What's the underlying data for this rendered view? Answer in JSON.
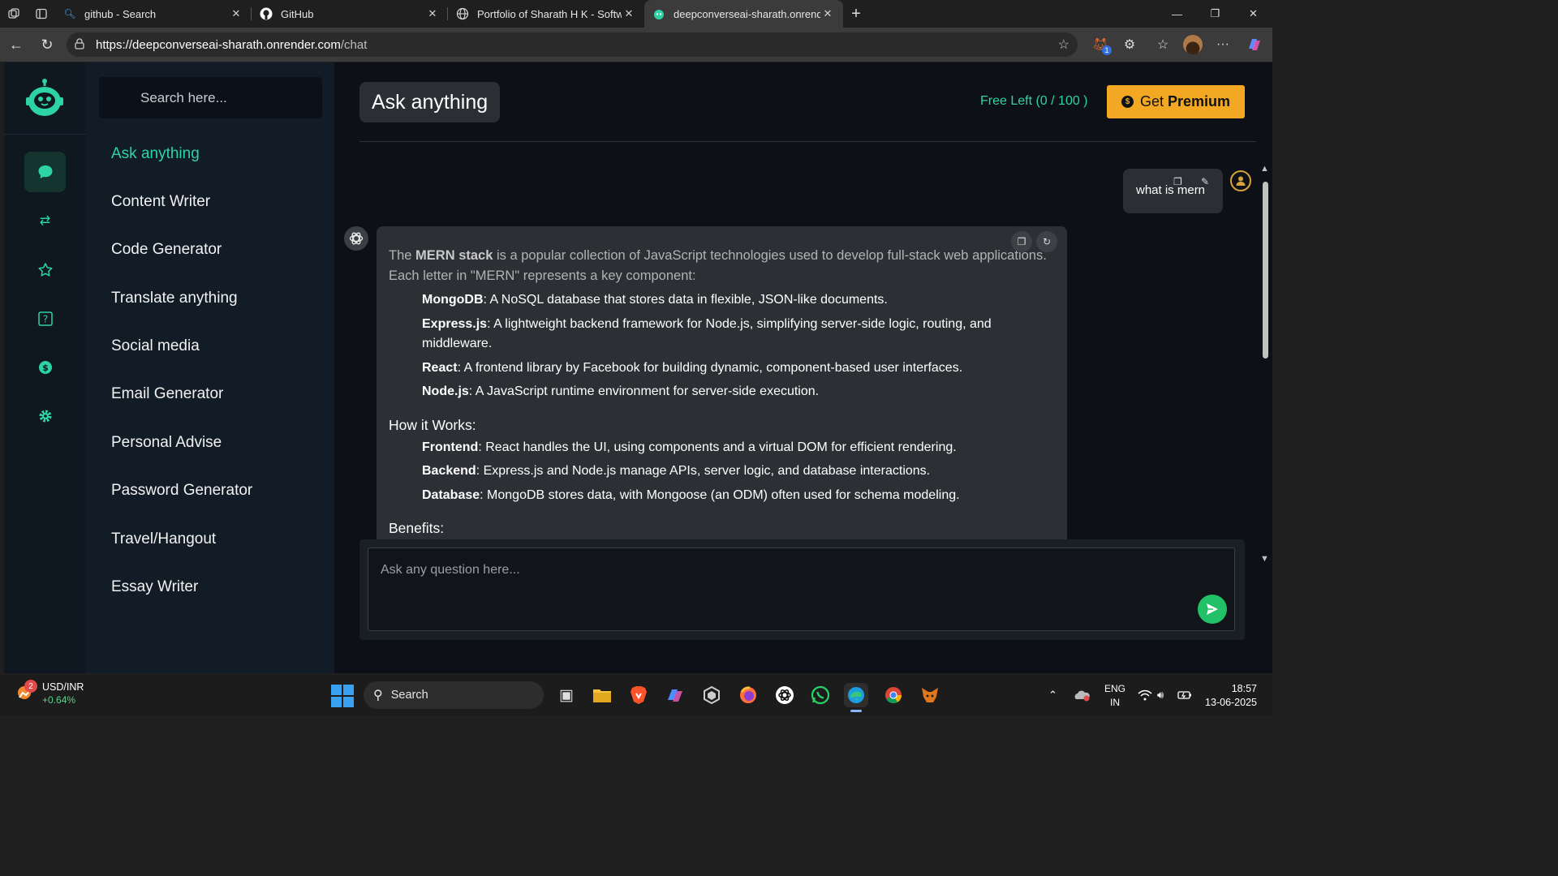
{
  "browser": {
    "tabs": [
      {
        "title": "github - Search",
        "icon": "search-icon"
      },
      {
        "title": "GitHub",
        "icon": "github-icon"
      },
      {
        "title": "Portfolio of Sharath H K - Softwar",
        "icon": "globe-icon"
      },
      {
        "title": "deepconverseai-sharath.onrender",
        "icon": "bot-favicon",
        "active": true
      }
    ],
    "url_host": "https://deepconverseai-sharath.onrender.com",
    "url_path": "/chat",
    "extension_badge": "1"
  },
  "sidebar": {
    "search_placeholder": "Search here...",
    "rail_icons": [
      "chat-icon",
      "swap-icon",
      "star-icon",
      "help-icon",
      "dollar-icon",
      "gear-icon"
    ],
    "items": [
      {
        "label": "Ask anything",
        "active": true
      },
      {
        "label": "Content Writer"
      },
      {
        "label": "Code Generator"
      },
      {
        "label": "Translate anything"
      },
      {
        "label": "Social media"
      },
      {
        "label": "Email Generator"
      },
      {
        "label": "Personal Advise"
      },
      {
        "label": "Password Generator"
      },
      {
        "label": "Travel/Hangout"
      },
      {
        "label": "Essay Writer"
      }
    ]
  },
  "header": {
    "title": "Ask anything",
    "free_left": "Free Left (0 / 100 )",
    "premium_prefix": "Get",
    "premium_bold": "Premium"
  },
  "chat": {
    "user_message": "what is mern",
    "bot": {
      "intro_pre": "The ",
      "intro_bold": "MERN stack",
      "intro_post": " is a popular collection of JavaScript technologies used to develop full-stack web applications. Each letter in \"MERN\" represents a key component:",
      "components": [
        {
          "term": "MongoDB",
          "desc": ": A NoSQL database that stores data in flexible, JSON-like documents."
        },
        {
          "term": "Express.js",
          "desc": ": A lightweight backend framework for Node.js, simplifying server-side logic, routing, and middleware."
        },
        {
          "term": "React",
          "desc": ": A frontend library by Facebook for building dynamic, component-based user interfaces."
        },
        {
          "term": "Node.js",
          "desc": ": A JavaScript runtime environment for server-side execution."
        }
      ],
      "how_heading": "How it Works:",
      "how_items": [
        {
          "term": "Frontend",
          "desc": ": React handles the UI, using components and a virtual DOM for efficient rendering."
        },
        {
          "term": "Backend",
          "desc": ": Express.js and Node.js manage APIs, server logic, and database interactions."
        },
        {
          "term": "Database",
          "desc": ": MongoDB stores data, with Mongoose (an ODM) often used for schema modeling."
        }
      ],
      "benefits_heading": "Benefits:"
    },
    "input_placeholder": "Ask any question here..."
  },
  "taskbar": {
    "stock_name": "USD/INR",
    "stock_change": "+0.64%",
    "stock_badge": "2",
    "search_label": "Search",
    "lang_line1": "ENG",
    "lang_line2": "IN",
    "time": "18:57",
    "date": "13-06-2025"
  },
  "colors": {
    "accent": "#2ed3a5",
    "premium": "#f3a823",
    "send": "#22c168"
  }
}
